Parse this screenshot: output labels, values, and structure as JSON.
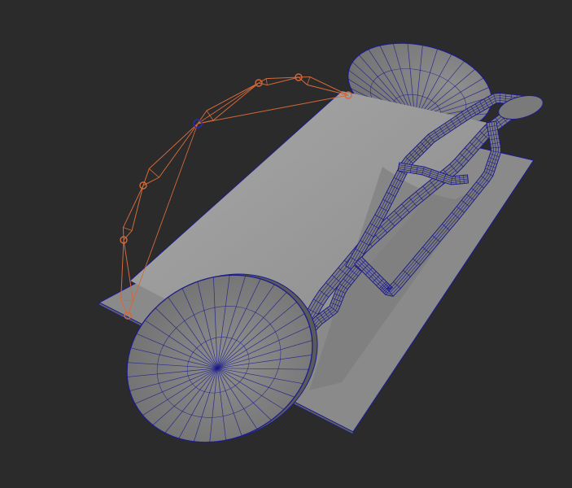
{
  "viewport": {
    "background": "#2b2b2b",
    "shading": "wireframe-on-shaded"
  },
  "scene": {
    "objects": [
      {
        "id": "base-plate",
        "kind": "box",
        "color": "#8a8a8a"
      },
      {
        "id": "cylinder-body",
        "kind": "cylinder",
        "color": "#9a9a9a"
      },
      {
        "id": "end-disc-front",
        "kind": "disc",
        "color": "#7e7e7e"
      },
      {
        "id": "end-disc-back",
        "kind": "disc",
        "color": "#7e7e7e"
      },
      {
        "id": "frame-mesh",
        "kind": "subdivided-mesh",
        "color": "#777777"
      },
      {
        "id": "bone-chain",
        "kind": "rig",
        "color": "#d2693a",
        "selected_joint_color": "#2a2ab8"
      }
    ],
    "wire_color": "#1c1c8c"
  }
}
